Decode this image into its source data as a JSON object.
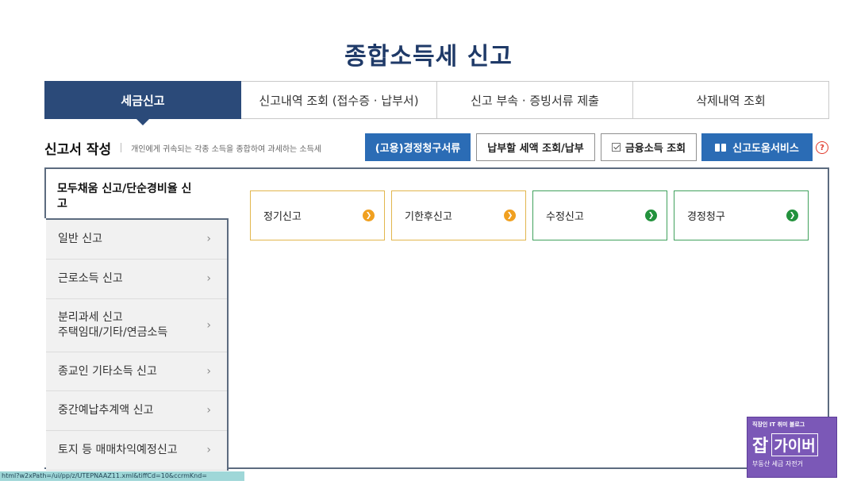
{
  "page": {
    "title": "종합소득세 신고"
  },
  "tabs": [
    {
      "label": "세금신고",
      "active": true
    },
    {
      "label": "신고내역 조회 (접수증 · 납부서)",
      "active": false
    },
    {
      "label": "신고 부속 · 증빙서류 제출",
      "active": false
    },
    {
      "label": "삭제내역 조회",
      "active": false
    }
  ],
  "section": {
    "title": "신고서 작성",
    "description": "개인에게 귀속되는 각종 소득을 종합하여 과세하는 소득세"
  },
  "toolbar": {
    "btn1": "(고용)경정청구서류",
    "btn2": "납부할 세액 조회/납부",
    "btn3": "금융소득 조회",
    "btn4": "신고도움서비스",
    "help": "?"
  },
  "sidebar": {
    "active_label": "모두채움 신고/단순경비율 신고",
    "items": [
      {
        "label": "일반 신고"
      },
      {
        "label": "근로소득 신고"
      },
      {
        "label": "분리과세 신고\n주택임대/기타/연금소득"
      },
      {
        "label": "종교인 기타소득 신고"
      },
      {
        "label": "중간예납추계액 신고"
      },
      {
        "label": "토지 등 매매차익예정신고"
      }
    ],
    "chevron": "›"
  },
  "cards": [
    {
      "label": "정기신고",
      "color": "#f0a020"
    },
    {
      "label": "기한후신고",
      "color": "#f0a020"
    },
    {
      "label": "수정신고",
      "color": "#23923d"
    },
    {
      "label": "경정청구",
      "color": "#23923d"
    }
  ],
  "status": {
    "url": "html?w2xPath=/ui/pp/z/UTEPNAAZ11.xml&tiffCd=10&ccrmKnd="
  },
  "watermark": {
    "top": "직장인 IT 취미 블로그",
    "big": "잡",
    "name": "가이버",
    "bottom": "부동산 세금 자전거"
  }
}
